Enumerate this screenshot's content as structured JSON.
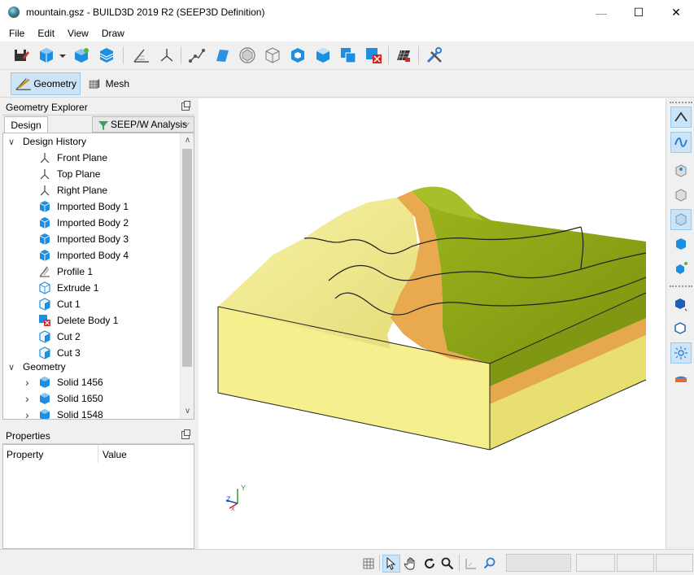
{
  "window": {
    "title": "mountain.gsz - BUILD3D 2019 R2 (SEEP3D Definition)",
    "minimize_glyph": "—",
    "maximize_glyph": "☐",
    "close_glyph": "✕"
  },
  "menu": [
    "File",
    "Edit",
    "View",
    "Draw"
  ],
  "modes": {
    "geometry": "Geometry",
    "mesh": "Mesh"
  },
  "explorer": {
    "title": "Geometry Explorer",
    "tab_design": "Design",
    "analysis": "SEEP/W Analysis",
    "design_history_label": "Design History",
    "design_history": [
      {
        "label": "Front Plane",
        "icon": "plane-axes-icon"
      },
      {
        "label": "Top Plane",
        "icon": "plane-axes-icon"
      },
      {
        "label": "Right Plane",
        "icon": "plane-axes-icon"
      },
      {
        "label": "Imported Body 1",
        "icon": "body-cube-icon"
      },
      {
        "label": "Imported Body 2",
        "icon": "body-cube-icon"
      },
      {
        "label": "Imported Body 3",
        "icon": "body-cube-icon"
      },
      {
        "label": "Imported Body 4",
        "icon": "body-cube-icon"
      },
      {
        "label": "Profile 1",
        "icon": "profile-icon"
      },
      {
        "label": "Extrude 1",
        "icon": "extrude-icon"
      },
      {
        "label": "Cut 1",
        "icon": "cut-icon"
      },
      {
        "label": "Delete Body 1",
        "icon": "delete-body-icon"
      },
      {
        "label": "Cut 2",
        "icon": "cut-icon"
      },
      {
        "label": "Cut 3",
        "icon": "cut-icon"
      }
    ],
    "geometry_label": "Geometry",
    "solids": [
      "Solid 1456",
      "Solid 1650",
      "Solid 1548"
    ]
  },
  "properties": {
    "title": "Properties",
    "col_property": "Property",
    "col_value": "Value"
  },
  "axes": {
    "y": "Y",
    "z": "Z",
    "x": "X"
  },
  "colors": {
    "soil_light": "#f2ee8c",
    "soil_orange": "#e8a94f",
    "soil_green": "#8ba114",
    "accent": "#2e7fd3"
  }
}
